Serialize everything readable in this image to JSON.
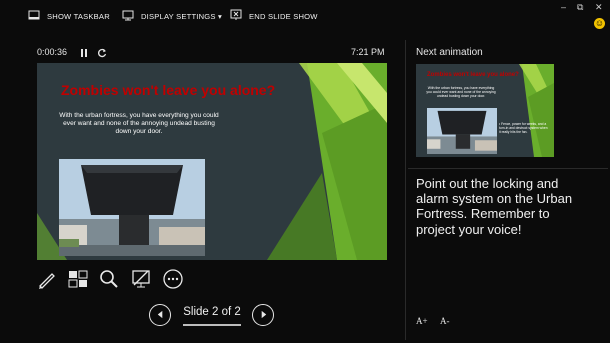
{
  "toolbar": {
    "show_taskbar": "SHOW TASKBAR",
    "display_settings": "DISPLAY SETTINGS ▾",
    "end_slide_show": "END SLIDE SHOW"
  },
  "window_controls": {
    "minimize": "–",
    "restore": "⧉",
    "close": "✕"
  },
  "status": {
    "timer": "0:00:36",
    "clock": "7:21 PM"
  },
  "slide": {
    "title": "Zombies won't leave you alone?",
    "body": "With the urban fortress, you have everything you could ever want and none of the annoying undead busting down your door."
  },
  "navigation": {
    "slide_count": "Slide 2 of 2"
  },
  "next_animation": {
    "label": "Next animation",
    "thumb_title": "Zombies won't leave you alone?",
    "thumb_body": "With the urban fortress, you have everything you could ever want and none of the annoying undead busting down your door.",
    "thumb_bullet": "•  Fence, power for weeks, and a turn-in and destruct system when it really hits the fan."
  },
  "notes": {
    "text": "Point out the locking and alarm system on the Urban Fortress. Remember to project your voice!"
  },
  "font_controls": {
    "increase": "A+",
    "decrease": "A-"
  },
  "colors": {
    "accent_green": "#6aae2c",
    "slide_bg": "#2e3a3f",
    "title_red": "#c00000"
  },
  "icons": [
    "taskbar-icon",
    "display-settings-icon",
    "end-show-icon",
    "pause-icon",
    "restart-icon",
    "pen-icon",
    "slides-grid-icon",
    "zoom-icon",
    "black-screen-icon",
    "more-icon",
    "prev-icon",
    "next-icon",
    "feedback-smiley-icon"
  ]
}
